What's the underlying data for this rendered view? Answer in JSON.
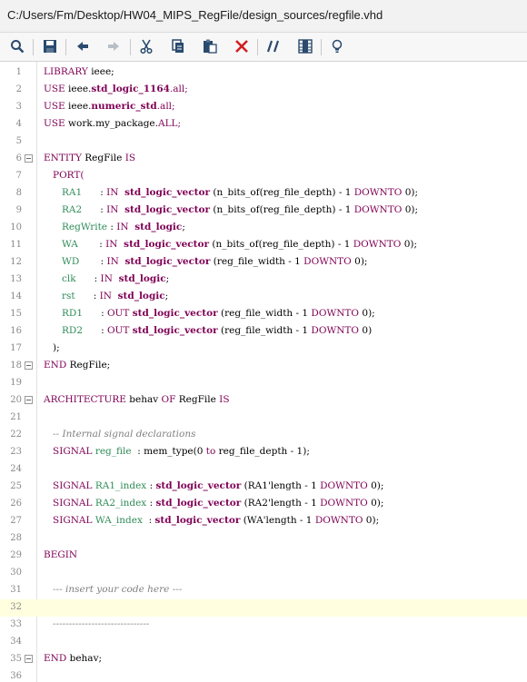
{
  "window": {
    "file_path": "C:/Users/Fm/Desktop/HW04_MIPS_RegFile/design_sources/regfile.vhd"
  },
  "toolbar": {
    "buttons": [
      {
        "name": "search-button",
        "icon": "search-icon",
        "label": "Search"
      },
      {
        "name": "save-button",
        "icon": "save-icon",
        "label": "Save"
      },
      {
        "name": "undo-button",
        "icon": "undo-icon",
        "label": "Undo"
      },
      {
        "name": "redo-button",
        "icon": "redo-icon",
        "label": "Redo"
      },
      {
        "name": "cut-button",
        "icon": "cut-icon",
        "label": "Cut"
      },
      {
        "name": "copy-button",
        "icon": "copy-icon",
        "label": "Copy"
      },
      {
        "name": "paste-button",
        "icon": "paste-icon",
        "label": "Paste"
      },
      {
        "name": "delete-button",
        "icon": "delete-icon",
        "label": "Delete"
      },
      {
        "name": "toggle-comment-button",
        "icon": "comment-icon",
        "label": "Toggle comment"
      },
      {
        "name": "column-select-button",
        "icon": "column-icon",
        "label": "Column select"
      },
      {
        "name": "hint-button",
        "icon": "lightbulb-icon",
        "label": "Hint"
      }
    ],
    "colors": {
      "delete": "#d11f1f",
      "icon": "#2a4a6e"
    }
  },
  "editor": {
    "current_line": 32,
    "lines": [
      {
        "n": "1",
        "fold": false,
        "tokens": [
          {
            "t": "LIBRARY ",
            "c": "kw"
          },
          {
            "t": "ieee;",
            "c": "txt"
          }
        ]
      },
      {
        "n": "2",
        "fold": false,
        "tokens": [
          {
            "t": "USE ",
            "c": "kw"
          },
          {
            "t": "ieee.",
            "c": "txt"
          },
          {
            "t": "std_logic_1164",
            "c": "typ"
          },
          {
            "t": ".all;",
            "c": "kw"
          }
        ]
      },
      {
        "n": "3",
        "fold": false,
        "tokens": [
          {
            "t": "USE ",
            "c": "kw"
          },
          {
            "t": "ieee.",
            "c": "txt"
          },
          {
            "t": "numeric_std",
            "c": "typ"
          },
          {
            "t": ".all;",
            "c": "kw"
          }
        ]
      },
      {
        "n": "4",
        "fold": false,
        "tokens": [
          {
            "t": "USE ",
            "c": "kw"
          },
          {
            "t": "work.my_package.",
            "c": "txt"
          },
          {
            "t": "ALL;",
            "c": "kw"
          }
        ]
      },
      {
        "n": "5",
        "fold": false,
        "tokens": []
      },
      {
        "n": "6",
        "fold": true,
        "tokens": [
          {
            "t": "ENTITY ",
            "c": "kw"
          },
          {
            "t": "RegFile ",
            "c": "txt"
          },
          {
            "t": "IS",
            "c": "kw"
          }
        ]
      },
      {
        "n": "7",
        "fold": false,
        "tokens": [
          {
            "t": "   PORT(",
            "c": "kw"
          }
        ]
      },
      {
        "n": "8",
        "fold": false,
        "tokens": [
          {
            "t": "      RA1      ",
            "c": "sig"
          },
          {
            "t": ": ",
            "c": "txt"
          },
          {
            "t": "IN  ",
            "c": "dir"
          },
          {
            "t": "std_logic_vector",
            "c": "typ"
          },
          {
            "t": " (n_bits_of(reg_file_depth) - 1 ",
            "c": "txt"
          },
          {
            "t": "DOWNTO",
            "c": "kw"
          },
          {
            "t": " 0);",
            "c": "txt"
          }
        ]
      },
      {
        "n": "9",
        "fold": false,
        "tokens": [
          {
            "t": "      RA2      ",
            "c": "sig"
          },
          {
            "t": ": ",
            "c": "txt"
          },
          {
            "t": "IN  ",
            "c": "dir"
          },
          {
            "t": "std_logic_vector",
            "c": "typ"
          },
          {
            "t": " (n_bits_of(reg_file_depth) - 1 ",
            "c": "txt"
          },
          {
            "t": "DOWNTO",
            "c": "kw"
          },
          {
            "t": " 0);",
            "c": "txt"
          }
        ]
      },
      {
        "n": "10",
        "fold": false,
        "tokens": [
          {
            "t": "      RegWrite ",
            "c": "sig"
          },
          {
            "t": ": ",
            "c": "txt"
          },
          {
            "t": "IN  ",
            "c": "dir"
          },
          {
            "t": "std_logic",
            "c": "typ"
          },
          {
            "t": ";",
            "c": "txt"
          }
        ]
      },
      {
        "n": "11",
        "fold": false,
        "tokens": [
          {
            "t": "      WA       ",
            "c": "sig"
          },
          {
            "t": ": ",
            "c": "txt"
          },
          {
            "t": "IN  ",
            "c": "dir"
          },
          {
            "t": "std_logic_vector",
            "c": "typ"
          },
          {
            "t": " (n_bits_of(reg_file_depth) - 1 ",
            "c": "txt"
          },
          {
            "t": "DOWNTO",
            "c": "kw"
          },
          {
            "t": " 0);",
            "c": "txt"
          }
        ]
      },
      {
        "n": "12",
        "fold": false,
        "tokens": [
          {
            "t": "      WD       ",
            "c": "sig"
          },
          {
            "t": ": ",
            "c": "txt"
          },
          {
            "t": "IN  ",
            "c": "dir"
          },
          {
            "t": "std_logic_vector",
            "c": "typ"
          },
          {
            "t": " (reg_file_width - 1 ",
            "c": "txt"
          },
          {
            "t": "DOWNTO",
            "c": "kw"
          },
          {
            "t": " 0);",
            "c": "txt"
          }
        ]
      },
      {
        "n": "13",
        "fold": false,
        "tokens": [
          {
            "t": "      clk      ",
            "c": "sig"
          },
          {
            "t": ": ",
            "c": "txt"
          },
          {
            "t": "IN  ",
            "c": "dir"
          },
          {
            "t": "std_logic",
            "c": "typ"
          },
          {
            "t": ";",
            "c": "txt"
          }
        ]
      },
      {
        "n": "14",
        "fold": false,
        "tokens": [
          {
            "t": "      rst      ",
            "c": "sig"
          },
          {
            "t": ": ",
            "c": "txt"
          },
          {
            "t": "IN  ",
            "c": "dir"
          },
          {
            "t": "std_logic",
            "c": "typ"
          },
          {
            "t": ";",
            "c": "txt"
          }
        ]
      },
      {
        "n": "15",
        "fold": false,
        "tokens": [
          {
            "t": "      RD1      ",
            "c": "sig"
          },
          {
            "t": ": ",
            "c": "txt"
          },
          {
            "t": "OUT ",
            "c": "dir"
          },
          {
            "t": "std_logic_vector",
            "c": "typ"
          },
          {
            "t": " (reg_file_width - 1 ",
            "c": "txt"
          },
          {
            "t": "DOWNTO",
            "c": "kw"
          },
          {
            "t": " 0);",
            "c": "txt"
          }
        ]
      },
      {
        "n": "16",
        "fold": false,
        "tokens": [
          {
            "t": "      RD2      ",
            "c": "sig"
          },
          {
            "t": ": ",
            "c": "txt"
          },
          {
            "t": "OUT ",
            "c": "dir"
          },
          {
            "t": "std_logic_vector",
            "c": "typ"
          },
          {
            "t": " (reg_file_width - 1 ",
            "c": "txt"
          },
          {
            "t": "DOWNTO",
            "c": "kw"
          },
          {
            "t": " 0)",
            "c": "txt"
          }
        ]
      },
      {
        "n": "17",
        "fold": false,
        "tokens": [
          {
            "t": "   );",
            "c": "txt"
          }
        ]
      },
      {
        "n": "18",
        "fold": true,
        "tokens": [
          {
            "t": "END ",
            "c": "kw"
          },
          {
            "t": "RegFile;",
            "c": "txt"
          }
        ]
      },
      {
        "n": "19",
        "fold": false,
        "tokens": []
      },
      {
        "n": "20",
        "fold": true,
        "tokens": [
          {
            "t": "ARCHITECTURE ",
            "c": "kw"
          },
          {
            "t": "behav ",
            "c": "txt"
          },
          {
            "t": "OF ",
            "c": "kw"
          },
          {
            "t": "RegFile ",
            "c": "txt"
          },
          {
            "t": "IS",
            "c": "kw"
          }
        ]
      },
      {
        "n": "21",
        "fold": false,
        "tokens": []
      },
      {
        "n": "22",
        "fold": false,
        "tokens": [
          {
            "t": "   -- Internal signal declarations",
            "c": "cmt"
          }
        ]
      },
      {
        "n": "23",
        "fold": false,
        "tokens": [
          {
            "t": "   SIGNAL ",
            "c": "kw"
          },
          {
            "t": "reg_file  ",
            "c": "sig"
          },
          {
            "t": ": mem_type(0 ",
            "c": "txt"
          },
          {
            "t": "to",
            "c": "kw"
          },
          {
            "t": " reg_file_depth - 1);",
            "c": "txt"
          }
        ]
      },
      {
        "n": "24",
        "fold": false,
        "tokens": []
      },
      {
        "n": "25",
        "fold": false,
        "tokens": [
          {
            "t": "   SIGNAL ",
            "c": "kw"
          },
          {
            "t": "RA1_index ",
            "c": "sig"
          },
          {
            "t": ": ",
            "c": "txt"
          },
          {
            "t": "std_logic_vector",
            "c": "typ"
          },
          {
            "t": " (RA1'length - 1 ",
            "c": "txt"
          },
          {
            "t": "DOWNTO",
            "c": "kw"
          },
          {
            "t": " 0);",
            "c": "txt"
          }
        ]
      },
      {
        "n": "26",
        "fold": false,
        "tokens": [
          {
            "t": "   SIGNAL ",
            "c": "kw"
          },
          {
            "t": "RA2_index ",
            "c": "sig"
          },
          {
            "t": ": ",
            "c": "txt"
          },
          {
            "t": "std_logic_vector",
            "c": "typ"
          },
          {
            "t": " (RA2'length - 1 ",
            "c": "txt"
          },
          {
            "t": "DOWNTO",
            "c": "kw"
          },
          {
            "t": " 0);",
            "c": "txt"
          }
        ]
      },
      {
        "n": "27",
        "fold": false,
        "tokens": [
          {
            "t": "   SIGNAL ",
            "c": "kw"
          },
          {
            "t": "WA_index  ",
            "c": "sig"
          },
          {
            "t": ": ",
            "c": "txt"
          },
          {
            "t": "std_logic_vector",
            "c": "typ"
          },
          {
            "t": " (WA'length - 1 ",
            "c": "txt"
          },
          {
            "t": "DOWNTO",
            "c": "kw"
          },
          {
            "t": " 0);",
            "c": "txt"
          }
        ]
      },
      {
        "n": "28",
        "fold": false,
        "tokens": []
      },
      {
        "n": "29",
        "fold": false,
        "tokens": [
          {
            "t": "BEGIN",
            "c": "kw"
          }
        ]
      },
      {
        "n": "30",
        "fold": false,
        "tokens": []
      },
      {
        "n": "31",
        "fold": false,
        "tokens": [
          {
            "t": "   --- insert your code here ---",
            "c": "cmt"
          }
        ]
      },
      {
        "n": "32",
        "fold": false,
        "tokens": []
      },
      {
        "n": "33",
        "fold": false,
        "tokens": [
          {
            "t": "   ------------------------------",
            "c": "cmt"
          }
        ]
      },
      {
        "n": "34",
        "fold": false,
        "tokens": []
      },
      {
        "n": "35",
        "fold": true,
        "tokens": [
          {
            "t": "END ",
            "c": "kw"
          },
          {
            "t": "behav;",
            "c": "txt"
          }
        ]
      },
      {
        "n": "36",
        "fold": false,
        "tokens": []
      }
    ]
  }
}
